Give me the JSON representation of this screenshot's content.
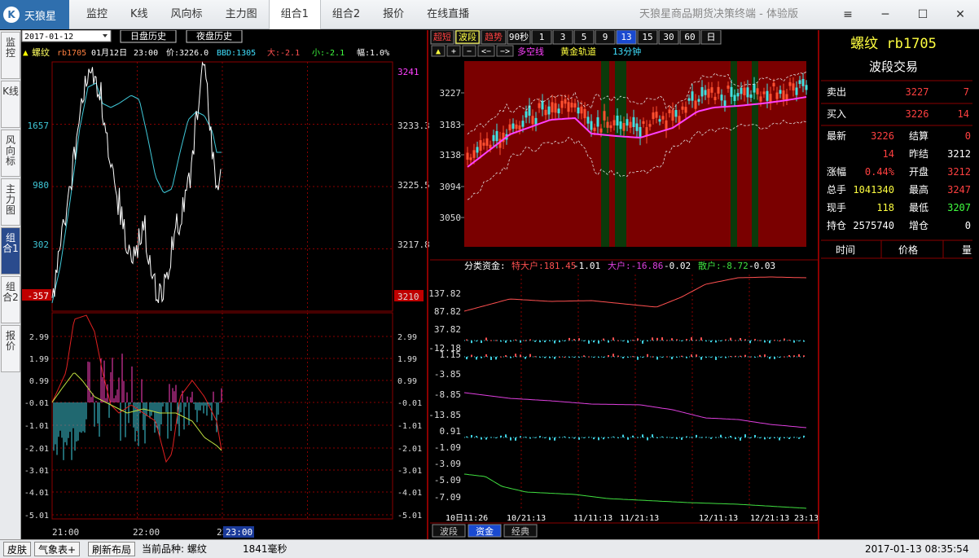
{
  "app": {
    "logo_text": "天狼星",
    "title": "天狼星商品期货决策终端 - 体验版",
    "menu": [
      "监控",
      "K线",
      "风向标",
      "主力图",
      "组合1",
      "组合2",
      "报价",
      "在线直播"
    ],
    "active_menu": 4,
    "win_buttons": [
      "≡",
      "─",
      "☐",
      "✕"
    ]
  },
  "left_tabs": [
    "监控",
    "K线",
    "风向标",
    "主力图",
    "组合1",
    "组合2",
    "报价"
  ],
  "active_left_tab": 4,
  "left_panel": {
    "date_select": "2017-01-12",
    "btn_day_history": "日盘历史",
    "btn_night_history": "夜盘历史",
    "info": {
      "symbol": "螺纹",
      "code": "rb1705",
      "date": "01月12日",
      "time": "23:00",
      "price_label": "价:3226.0",
      "bbd": "BBD:1305",
      "big": "大:-2.1",
      "small": "小:-2.1",
      "range": "幅:1.0%"
    },
    "left_axis": [
      "1657",
      "980",
      "302",
      "-357"
    ],
    "right_axis": [
      "3241",
      "3233.3",
      "3225.5",
      "3217.8",
      "3210"
    ],
    "osc_axis": [
      "2.99",
      "1.99",
      "0.99",
      "-0.01",
      "-1.01",
      "-2.01",
      "-3.01",
      "-4.01",
      "-5.01"
    ],
    "time_axis": [
      "21:00",
      "22:00",
      "23:",
      "23:00"
    ]
  },
  "middle_panel": {
    "period_buttons": [
      "超短",
      "波段",
      "趋势",
      "90秒",
      "1",
      "3",
      "5",
      "9",
      "13",
      "15",
      "30",
      "60",
      "日"
    ],
    "active_period": 8,
    "active_mode": 1,
    "toolbar": [
      "▲",
      "+",
      "−",
      "<−",
      "−>"
    ],
    "indicator_labels": [
      "多空线",
      "黄金轨道",
      "13分钟"
    ],
    "kline_axis": [
      "3227",
      "3183",
      "3138",
      "3094",
      "3050"
    ],
    "fund_title": "分类资金:",
    "fund_items": [
      {
        "label": "特大户:181.45",
        "delta": "-1.01",
        "color": "#ff5050"
      },
      {
        "label": "大户:-16.86",
        "delta": "-0.02",
        "color": "#e040e0"
      },
      {
        "label": "散户:-8.72",
        "delta": "-0.03",
        "color": "#40e040"
      }
    ],
    "fund_axis": [
      "137.82",
      "87.82",
      "37.82",
      "-12.18",
      "1.15",
      "-3.85",
      "-8.85",
      "-13.85",
      "0.91",
      "-1.09",
      "-3.09",
      "-5.09",
      "-7.09"
    ],
    "date_axis": [
      "10日11:26",
      "10/21:13",
      "11/11:13",
      "11/21:13",
      "12/11:13",
      "12/21:13",
      "23:13"
    ],
    "bottom_tabs": [
      "波段",
      "资金",
      "经典"
    ],
    "active_bottom_tab": 1
  },
  "right_panel": {
    "title": "螺纹 rb1705",
    "subtitle": "波段交易",
    "sell": {
      "label": "卖出",
      "price": "3227",
      "vol": "7"
    },
    "buy": {
      "label": "买入",
      "price": "3226",
      "vol": "14"
    },
    "rows": [
      [
        {
          "l": "最新",
          "v": "3226",
          "c": "#ff4040"
        },
        {
          "l": "结算",
          "v": "0",
          "c": "#ff4040"
        }
      ],
      [
        {
          "l": "",
          "v": "14",
          "c": "#ff4040"
        },
        {
          "l": "昨结",
          "v": "3212",
          "c": "#ffffff"
        }
      ],
      [
        {
          "l": "涨幅",
          "v": "0.44%",
          "c": "#ff4040"
        },
        {
          "l": "开盘",
          "v": "3212",
          "c": "#ff4040"
        }
      ],
      [
        {
          "l": "总手",
          "v": "1041340",
          "c": "#ffff40"
        },
        {
          "l": "最高",
          "v": "3247",
          "c": "#ff4040"
        }
      ],
      [
        {
          "l": "现手",
          "v": "118",
          "c": "#ffff40"
        },
        {
          "l": "最低",
          "v": "3207",
          "c": "#40ff40"
        }
      ],
      [
        {
          "l": "持仓",
          "v": "2575740",
          "c": "#ffffff"
        },
        {
          "l": "增仓",
          "v": "0",
          "c": "#ffffff"
        }
      ]
    ],
    "tick_headers": [
      "时间",
      "价格",
      "量"
    ]
  },
  "status": {
    "skin": "皮肤",
    "weather": "气象表+",
    "refresh": "刷新布局",
    "current": "当前品种: 螺纹",
    "latency": "1841毫秒",
    "datetime": "2017-01-13 08:35:54"
  }
}
